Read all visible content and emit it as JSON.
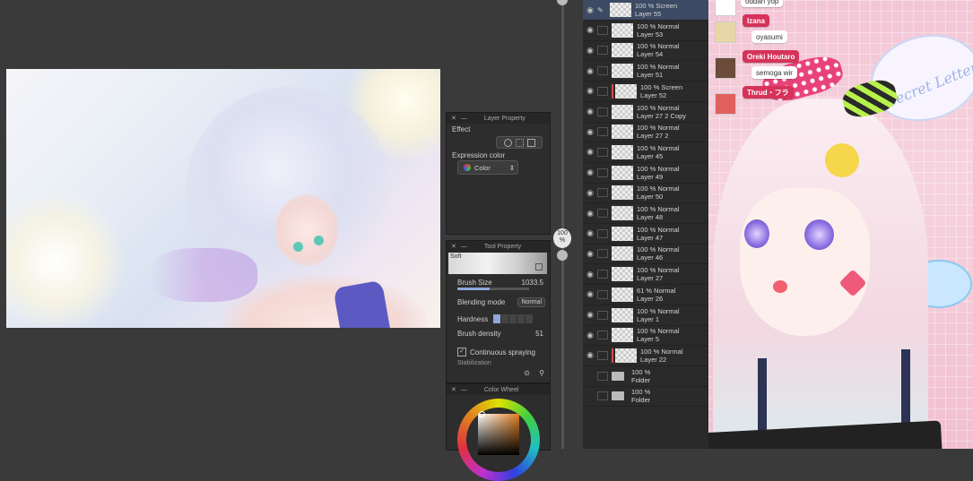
{
  "layer_property": {
    "title": "Layer Property",
    "effect_label": "Effect",
    "expression_color_label": "Expression color",
    "expression_color_value": "Color"
  },
  "tool_property": {
    "title": "Tool Property",
    "brush_name": "Soft",
    "brush_size_label": "Brush Size",
    "brush_size_value": "1033.5",
    "blending_mode_label": "Blending mode",
    "blending_mode_value": "Normal",
    "hardness_label": "Hardness",
    "brush_density_label": "Brush density",
    "brush_density_value": "51",
    "continuous_spraying_label": "Continuous spraying",
    "continuous_spraying_checked": true,
    "stabilization_label": "Stabilization"
  },
  "color_wheel": {
    "title": "Color Wheel"
  },
  "zoom_slider": {
    "value_label": "100\n%"
  },
  "layers": [
    {
      "opacity_mode": "100 % Screen",
      "name": "Layer 55",
      "selected": true
    },
    {
      "opacity_mode": "100 % Normal",
      "name": "Layer 53"
    },
    {
      "opacity_mode": "100 % Normal",
      "name": "Layer 54"
    },
    {
      "opacity_mode": "100 % Normal",
      "name": "Layer 51"
    },
    {
      "opacity_mode": "100 % Screen",
      "name": "Layer 52",
      "marker": true
    },
    {
      "opacity_mode": "100 % Normal",
      "name": "Layer 27 2 Copy"
    },
    {
      "opacity_mode": "100 % Normal",
      "name": "Layer 27 2"
    },
    {
      "opacity_mode": "100 % Normal",
      "name": "Layer 45"
    },
    {
      "opacity_mode": "100 % Normal",
      "name": "Layer 49"
    },
    {
      "opacity_mode": "100 % Normal",
      "name": "Layer 50"
    },
    {
      "opacity_mode": "100 % Normal",
      "name": "Layer 48"
    },
    {
      "opacity_mode": "100 % Normal",
      "name": "Layer 47"
    },
    {
      "opacity_mode": "100 % Normal",
      "name": "Layer 46"
    },
    {
      "opacity_mode": "100 % Normal",
      "name": "Layer 27"
    },
    {
      "opacity_mode": "61 % Normal",
      "name": "Layer 26"
    },
    {
      "opacity_mode": "100 % Normal",
      "name": "Layer 1"
    },
    {
      "opacity_mode": "100 % Normal",
      "name": "Layer 5"
    },
    {
      "opacity_mode": "100 % Normal",
      "name": "Layer 22",
      "marker": true
    },
    {
      "opacity_mode": "100 %",
      "name": "Folder"
    },
    {
      "opacity_mode": "100 %",
      "name": "Folder"
    }
  ],
  "stream_chat": [
    {
      "text": "oddan yop"
    },
    {
      "text": "Izana",
      "is_name": true
    },
    {
      "text": "oyasumi"
    },
    {
      "text": "Oreki Houtaro",
      "is_name": true
    },
    {
      "text": "semoga wir"
    },
    {
      "text": "Thrud・フラ",
      "is_name": true
    }
  ],
  "overlay_text": "Secret Letter",
  "colors": {
    "app_bg": "#3a3a3a",
    "panel_bg": "#2d2d2d",
    "accent_name": "#d6335a",
    "overlay_pink": "#f3c6d6"
  },
  "icons": [
    "eye-icon",
    "pencil-icon",
    "lock-icon",
    "folder-icon",
    "chevron-icon",
    "close-icon",
    "minimize-icon",
    "checkbox-icon",
    "search-icon"
  ]
}
